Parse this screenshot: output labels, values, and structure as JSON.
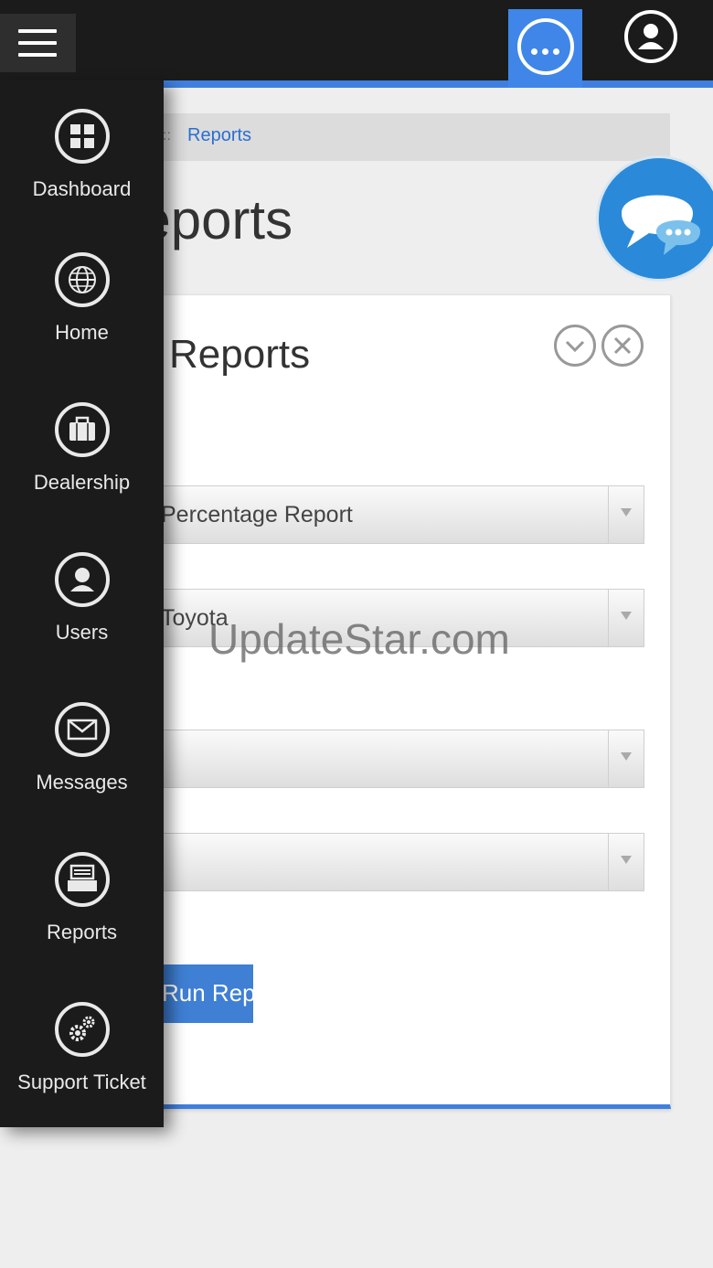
{
  "header": {
    "menu_icon": "hamburger-icon",
    "more_icon": "more-horizontal-icon",
    "user_icon": "user-circle-icon",
    "accent": "#3f7fe0"
  },
  "breadcrumb": {
    "separator": "::",
    "current": "Reports"
  },
  "page": {
    "title": "Reports"
  },
  "panel": {
    "title": "Reports",
    "fields": [
      {
        "value": "Percentage Report"
      },
      {
        "value": "Toyota"
      },
      {
        "value": ""
      },
      {
        "value": ""
      }
    ],
    "run_button": "Run Report"
  },
  "chat": {
    "icon": "chat-bubbles-icon"
  },
  "watermark": "UpdateStar.com",
  "sidebar": {
    "items": [
      {
        "label": "Dashboard",
        "icon": "dashboard-icon"
      },
      {
        "label": "Home",
        "icon": "globe-icon"
      },
      {
        "label": "Dealership",
        "icon": "briefcase-icon"
      },
      {
        "label": "Users",
        "icon": "user-icon"
      },
      {
        "label": "Messages",
        "icon": "envelope-icon"
      },
      {
        "label": "Reports",
        "icon": "inbox-tray-icon"
      },
      {
        "label": "Support Ticket",
        "icon": "gears-icon"
      }
    ]
  }
}
